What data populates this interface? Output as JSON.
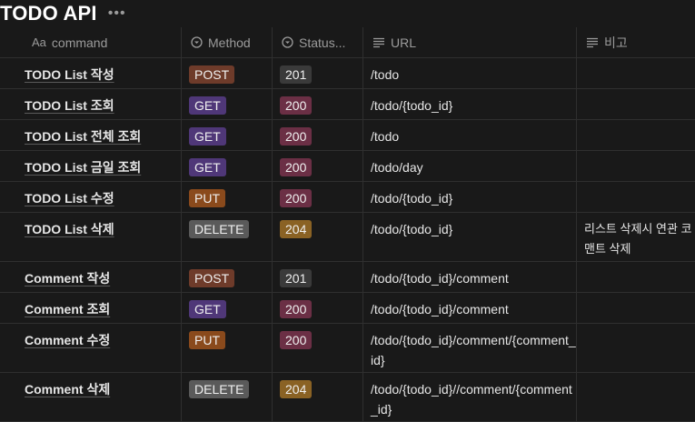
{
  "title": "TODO API",
  "more_icon": "more-horizontal-icon",
  "headers": {
    "command": "command",
    "method": "Method",
    "status": "Status...",
    "url": "URL",
    "note": "비고"
  },
  "colors": {
    "POST": "#6e3b2a",
    "GET": "#4f3778",
    "PUT": "#8a4a1c",
    "DELETE": "#5a5a5a",
    "201": "#3a3a3a",
    "200": "#6b2f45",
    "204": "#8a6224"
  },
  "rows": [
    {
      "command": "TODO List 작성",
      "method": "POST",
      "status": "201",
      "url": "/todo",
      "note": ""
    },
    {
      "command": "TODO List 조회",
      "method": "GET",
      "status": "200",
      "url": "/todo/{todo_id}",
      "note": ""
    },
    {
      "command": "TODO List 전체 조회",
      "method": "GET",
      "status": "200",
      "url": "/todo",
      "note": ""
    },
    {
      "command": "TODO List 금일 조회",
      "method": "GET",
      "status": "200",
      "url": "/todo/day",
      "note": ""
    },
    {
      "command": "TODO List 수정",
      "method": "PUT",
      "status": "200",
      "url": "/todo/{todo_id}",
      "note": ""
    },
    {
      "command": "TODO List 삭제",
      "method": "DELETE",
      "status": "204",
      "url": "/todo/{todo_id}",
      "note": "리스트 삭제시 연관 코맨트 삭제"
    },
    {
      "command": "Comment 작성",
      "method": "POST",
      "status": "201",
      "url": "/todo/{todo_id}/comment",
      "note": ""
    },
    {
      "command": "Comment 조회",
      "method": "GET",
      "status": "200",
      "url": "/todo/{todo_id}/comment",
      "note": ""
    },
    {
      "command": "Comment 수정",
      "method": "PUT",
      "status": "200",
      "url": "/todo/{todo_id}/comment/{comment_id}",
      "note": ""
    },
    {
      "command": "Comment 삭제",
      "method": "DELETE",
      "status": "204",
      "url": "/todo/{todo_id}//comment/{comment_id}",
      "note": ""
    }
  ]
}
